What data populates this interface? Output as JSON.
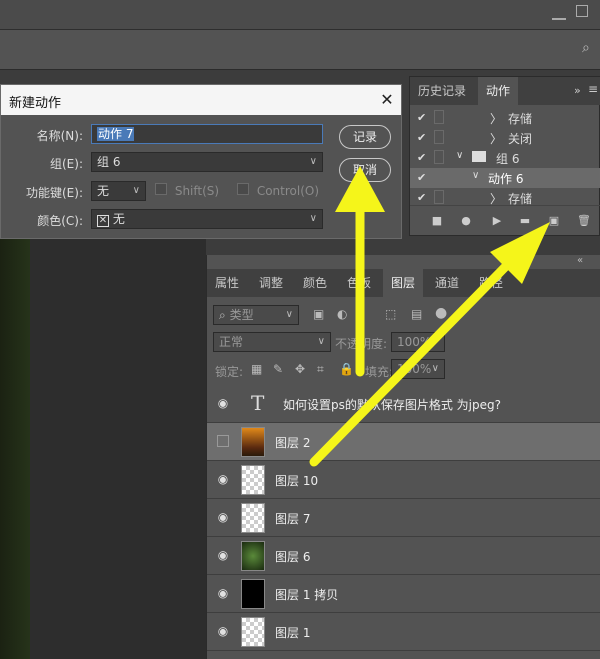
{
  "dialog": {
    "title": "新建动作",
    "name_label": "名称(N):",
    "name_value": "动作 7",
    "group_label": "组(E):",
    "group_value": "组 6",
    "fkey_label": "功能键(E):",
    "fkey_value": "无",
    "shift_label": "Shift(S)",
    "control_label": "Control(O)",
    "color_label": "颜色(C):",
    "color_value": "无",
    "record_button": "记录",
    "cancel_button": "取消"
  },
  "actions_panel": {
    "tabs": [
      {
        "label": "历史记录"
      },
      {
        "label": "动作"
      }
    ],
    "rows": [
      {
        "label": "存储"
      },
      {
        "label": "关闭"
      },
      {
        "label": "组 6"
      },
      {
        "label": "动作 6"
      },
      {
        "label": "存储"
      }
    ]
  },
  "layers_panel": {
    "tabs": [
      {
        "label": "属性"
      },
      {
        "label": "调整"
      },
      {
        "label": "颜色"
      },
      {
        "label": "色板"
      },
      {
        "label": "图层"
      },
      {
        "label": "通道"
      },
      {
        "label": "路径"
      }
    ],
    "filter_placeholder": "类型",
    "blend_mode": "正常",
    "opacity_label": "不透明度:",
    "opacity_value": "100%",
    "lock_label": "锁定:",
    "fill_label": "填充:",
    "fill_value": "100%",
    "layers": [
      {
        "name": "如何设置ps的默认保存图片格式 为jpeg?"
      },
      {
        "name": "图层 2"
      },
      {
        "name": "图层 10"
      },
      {
        "name": "图层 7"
      },
      {
        "name": "图层 6"
      },
      {
        "name": "图层 1 拷贝"
      },
      {
        "name": "图层 1"
      }
    ]
  },
  "colors": {
    "arrow": "#f5f51a",
    "selection": "#4a7ab8"
  }
}
